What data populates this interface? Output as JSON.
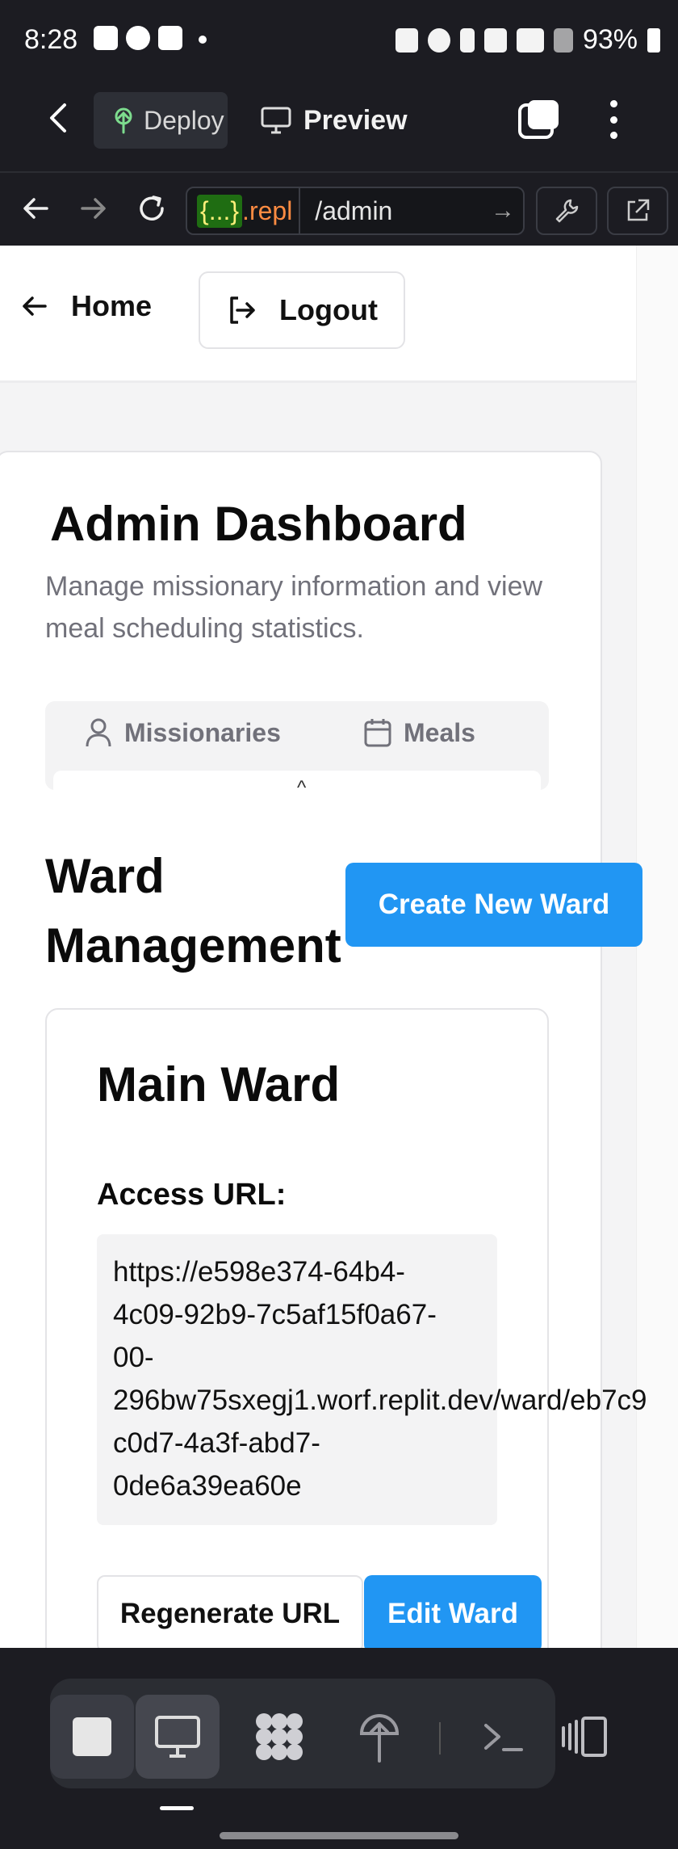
{
  "status_bar": {
    "time": "8:28",
    "battery": "93%"
  },
  "app_toolbar": {
    "deploy_label": "Deploy",
    "preview_label": "Preview"
  },
  "url_bar": {
    "host_brace": "{...}",
    "host_rest": ".repl",
    "path": "/admin"
  },
  "page": {
    "nav": {
      "home_label": "Home",
      "logout_label": "Logout"
    },
    "dashboard": {
      "title": "Admin Dashboard",
      "subtitle": "Manage missionary information and view meal scheduling statistics.",
      "tabs": [
        {
          "label": "Missionaries",
          "icon": "user-icon"
        },
        {
          "label": "Meals",
          "icon": "calendar-icon"
        }
      ]
    },
    "ward_management": {
      "title_line1": "Ward",
      "title_line2": "Management",
      "create_button": "Create New Ward",
      "ward": {
        "name": "Main Ward",
        "access_label": "Access URL:",
        "access_url": "https://e598e374-64b4-\n4c09-92b9-7c5af15f0a67-\n00-\n296bw75sxegj1.worf.replit.dev/ward/eb7c9\nc0d7-4a3f-abd7-\n0de6a39ea60e",
        "regenerate_button": "Regenerate URL",
        "edit_button": "Edit Ward"
      }
    }
  },
  "colors": {
    "primary": "#2196f3",
    "muted_text": "#71717a",
    "dark_chrome": "#1c1c22"
  }
}
